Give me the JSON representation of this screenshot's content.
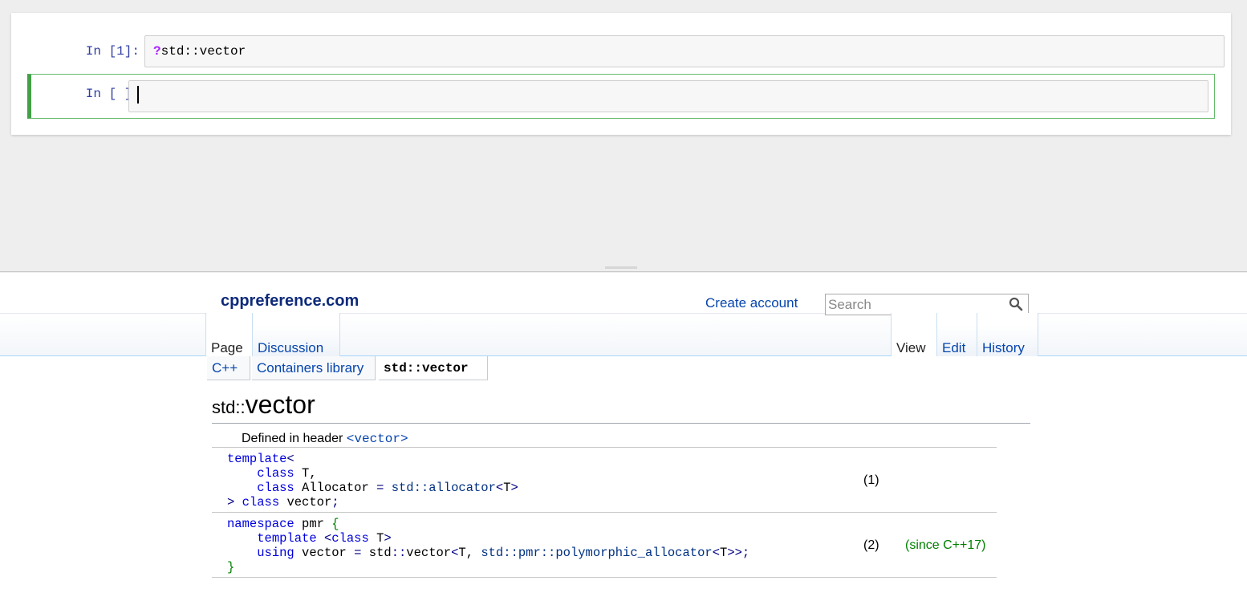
{
  "notebook": {
    "cells": [
      {
        "prompt": "In [1]:",
        "input_mark": "?",
        "input_text": "std::vector",
        "selected": false
      },
      {
        "prompt": "In [ ]:",
        "input_mark": "",
        "input_text": "",
        "selected": true
      }
    ]
  },
  "pager": {
    "site_name": "cppreference.com",
    "create_account": "Create account",
    "search_placeholder": "Search",
    "left_tabs": [
      "Page",
      "Discussion"
    ],
    "right_tabs": [
      "View",
      "Edit",
      "History"
    ],
    "breadcrumbs": [
      "C++",
      "Containers library",
      "std::vector"
    ],
    "title_namespace": "std::",
    "title_name": "vector",
    "defined_in_label": "Defined in header",
    "header_link": "<vector>",
    "declarations": [
      {
        "num": "(1)",
        "since": "",
        "lines": [
          [
            [
              "kw",
              "template"
            ],
            [
              "op",
              "<"
            ]
          ],
          [
            [
              "",
              "    "
            ],
            [
              "kw",
              "class"
            ],
            [
              "",
              " T,"
            ]
          ],
          [
            [
              "",
              "    "
            ],
            [
              "kw",
              "class"
            ],
            [
              "",
              " Allocator "
            ],
            [
              "op",
              "="
            ],
            [
              "",
              " "
            ],
            [
              "ty",
              "std::allocator"
            ],
            [
              "op",
              "<"
            ],
            [
              "",
              "T"
            ],
            [
              "op",
              ">"
            ]
          ],
          [
            [
              "op",
              ">"
            ],
            [
              "",
              " "
            ],
            [
              "kw",
              "class"
            ],
            [
              "",
              " vector"
            ],
            [
              "op",
              ";"
            ]
          ]
        ]
      },
      {
        "num": "(2)",
        "since": "(since C++17)",
        "lines": [
          [
            [
              "kw",
              "namespace"
            ],
            [
              "",
              " pmr "
            ],
            [
              "br",
              "{"
            ]
          ],
          [
            [
              "",
              "    "
            ],
            [
              "kw",
              "template"
            ],
            [
              "",
              " "
            ],
            [
              "op",
              "<"
            ],
            [
              "kw",
              "class"
            ],
            [
              "",
              " T"
            ],
            [
              "op",
              ">"
            ]
          ],
          [
            [
              "",
              "    "
            ],
            [
              "kw",
              "using"
            ],
            [
              "",
              " vector "
            ],
            [
              "op",
              "="
            ],
            [
              "",
              " std"
            ],
            [
              "op",
              "::"
            ],
            [
              "",
              "vector"
            ],
            [
              "op",
              "<"
            ],
            [
              "",
              "T, "
            ],
            [
              "ty",
              "std::pmr::polymorphic_allocator"
            ],
            [
              "op",
              "<"
            ],
            [
              "",
              "T"
            ],
            [
              "op",
              ">>"
            ],
            [
              "op",
              ";"
            ]
          ],
          [
            [
              "br",
              "}"
            ]
          ]
        ]
      }
    ]
  },
  "colors": {
    "prompt": "#303f9f",
    "selected_cell_border": "#42a047",
    "link": "#0645ad",
    "since": "#008000"
  }
}
